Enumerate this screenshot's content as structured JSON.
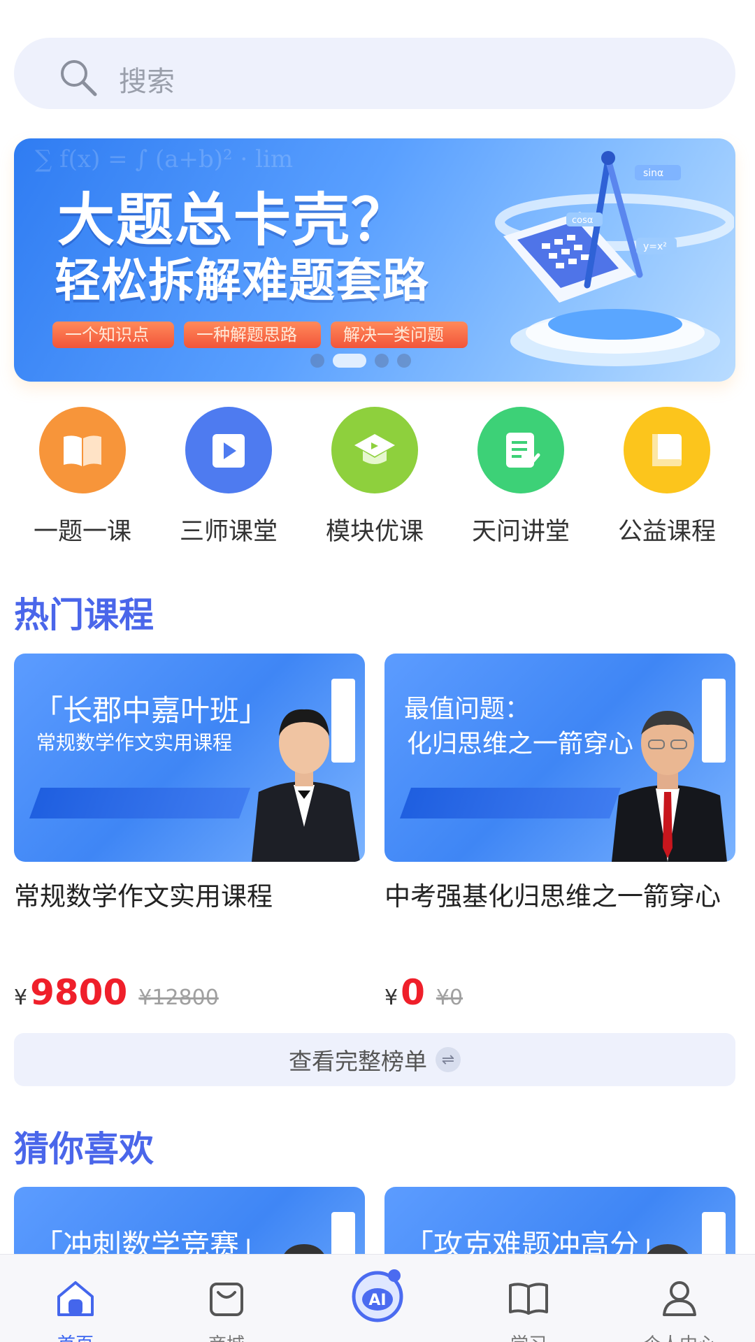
{
  "search": {
    "placeholder": "搜索",
    "icon": "search-icon"
  },
  "banner": {
    "headline": "大题总卡壳？",
    "subline": "轻松拆解难题套路",
    "tags": [
      "一个知识点",
      "一种解题思路",
      "解决一类问题"
    ],
    "illustration_labels": [
      "cosα",
      "sinα",
      "y=x²"
    ],
    "active_slide": 2,
    "slide_count": 4
  },
  "categories": [
    {
      "label": "一题一课",
      "icon": "open-book-icon",
      "color": "#f7953a"
    },
    {
      "label": "三师课堂",
      "icon": "play-icon",
      "color": "#4e7bf0"
    },
    {
      "label": "模块优课",
      "icon": "graduation-cap-icon",
      "color": "#8ed03d"
    },
    {
      "label": "天问讲堂",
      "icon": "notes-icon",
      "color": "#3dd177"
    },
    {
      "label": "公益课程",
      "icon": "book-icon",
      "color": "#fcc51c"
    }
  ],
  "hot": {
    "title": "热门课程",
    "courses": [
      {
        "thumb_line1": "「长郡中嘉叶班」",
        "thumb_line2": "常规数学作文实用课程",
        "title": "常规数学作文实用课程",
        "currency": "¥",
        "price": "9800",
        "original_price": "¥12800"
      },
      {
        "thumb_line1": "最值问题：",
        "thumb_line2": "化归思维之一箭穿心",
        "title": "中考强基化归思维之一箭穿心",
        "currency": "¥",
        "price": "0",
        "original_price": "¥0"
      }
    ],
    "more_label": "查看完整榜单"
  },
  "guess": {
    "title": "猜你喜欢",
    "courses": [
      {
        "thumb_line1": "「冲刺数学竞赛」"
      },
      {
        "thumb_line1": "「攻克难题冲高分」"
      }
    ]
  },
  "tabbar": {
    "tabs": [
      {
        "label": "首页",
        "icon": "home-icon",
        "active": true
      },
      {
        "label": "商城",
        "icon": "shopping-bag-icon"
      },
      {
        "label": "AI",
        "icon": "ai-robot-icon"
      },
      {
        "label": "学习",
        "icon": "book-icon"
      },
      {
        "label": "个人中心",
        "icon": "user-icon"
      }
    ]
  },
  "colors": {
    "accent": "#4a66ea",
    "price": "#ef1f2a",
    "search_bg": "#eef1fc"
  }
}
